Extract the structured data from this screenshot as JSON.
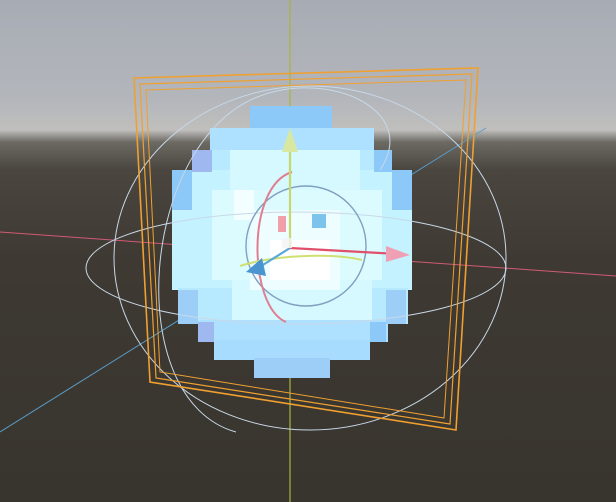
{
  "viewport": {
    "label": "",
    "sky_color": "#b3b6bb",
    "ground_color": "#3a3631"
  },
  "colors": {
    "axis_x": "#e0506a",
    "axis_y": "#b8d24a",
    "axis_z": "#5aa8d8",
    "bounds_frame": "#f0a030",
    "rotate_gizmo": "#c8d8e8",
    "sprite_light": "#c8f4ff",
    "sprite_mid": "#a8dcff",
    "sprite_dark": "#8cc8f8",
    "sprite_white": "#ffffff"
  },
  "icons": {
    "move_gizmo": "move-gizmo-icon",
    "rotate_gizmo": "rotate-gizmo-icon",
    "bounds": "bounding-box-icon"
  }
}
